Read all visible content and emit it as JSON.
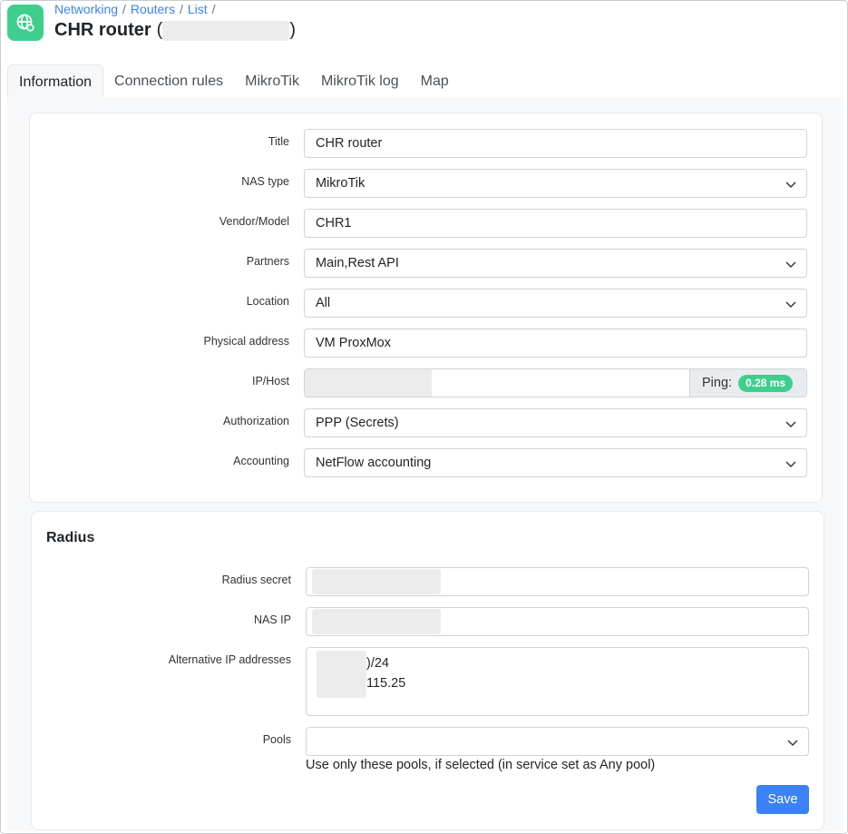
{
  "breadcrumb": [
    "Networking",
    "Routers",
    "List"
  ],
  "page": {
    "title": "CHR router",
    "paren_open": "(",
    "paren_close": ")"
  },
  "tabs": [
    "Information",
    "Connection rules",
    "MikroTik",
    "MikroTik log",
    "Map"
  ],
  "active_tab": "Information",
  "info": {
    "title_label": "Title",
    "title_value": "CHR router",
    "nas_type_label": "NAS type",
    "nas_type_value": "MikroTik",
    "vendor_label": "Vendor/Model",
    "vendor_value": "CHR1",
    "partners_label": "Partners",
    "partners_value": "Main,Rest API",
    "location_label": "Location",
    "location_value": "All",
    "physical_label": "Physical address",
    "physical_value": "VM ProxMox",
    "iphost_label": "IP/Host",
    "iphost_value": "",
    "ping_label": "Ping:",
    "ping_value": "0.28 ms",
    "authorization_label": "Authorization",
    "authorization_value": "PPP (Secrets)",
    "accounting_label": "Accounting",
    "accounting_value": "NetFlow accounting"
  },
  "radius": {
    "heading": "Radius",
    "secret_label": "Radius secret",
    "secret_value": "",
    "nas_ip_label": "NAS IP",
    "nas_ip_value": "",
    "alt_ip_label": "Alternative IP addresses",
    "alt_ip_lines": [
      ")/24",
      "115.25"
    ],
    "pools_label": "Pools",
    "pools_value": "",
    "pools_help": "Use only these pools, if selected (in service set as Any pool)",
    "save_label": "Save"
  },
  "colors": {
    "accent": "#3b82f6",
    "brand": "#3ecf8e",
    "badge": "#3ecf8e"
  },
  "icons": {
    "page": "globe-network-icon",
    "select": "chevron-down-icon"
  }
}
